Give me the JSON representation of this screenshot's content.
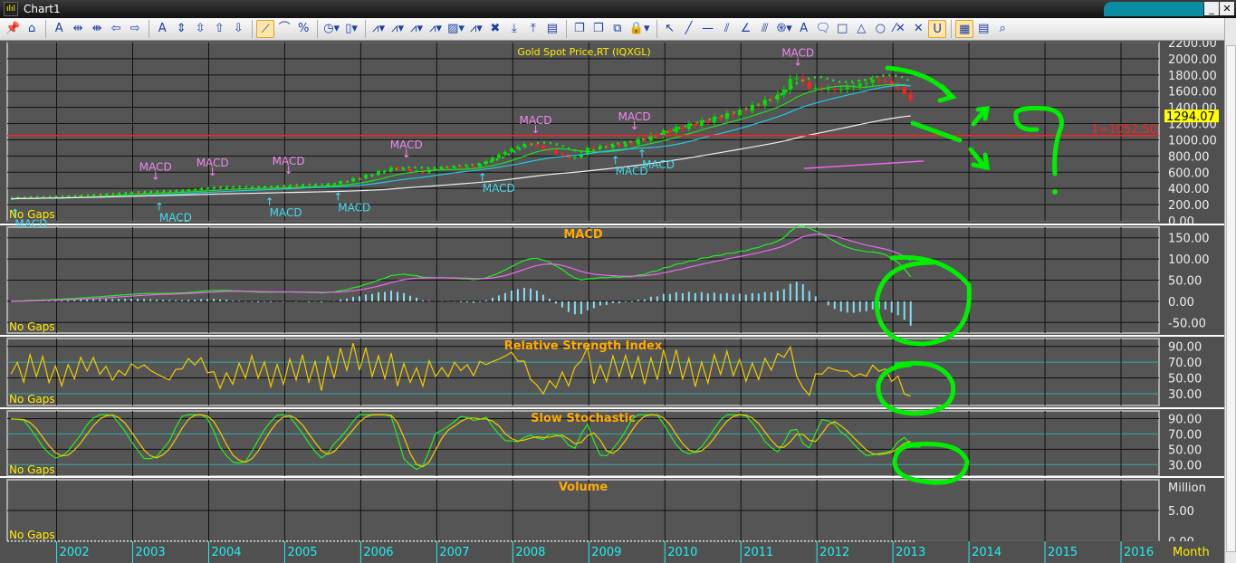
{
  "window": {
    "title": "Chart1",
    "minimize": "_",
    "maximize": "□",
    "close": "✕"
  },
  "toolbar": {
    "icons": [
      "pin-icon",
      "home-icon",
      "|",
      "font-icon",
      "zoom-in-horizontal-icon",
      "zoom-out-horizontal-icon",
      "arrow-left-icon",
      "arrow-right-icon",
      "|",
      "axis-font-icon",
      "expand-vertical-icon",
      "compress-vertical-icon",
      "arrow-up-icon",
      "arrow-down-icon",
      "|",
      "linear-scale-icon",
      "log-scale-icon",
      "percent-scale-icon",
      "|",
      "timer-icon",
      "candlestick-icon",
      "|",
      "add-indicator-icon",
      "add-study-icon",
      "indicator-overlay-icon",
      "indicator-panel-icon",
      "style-icon",
      "remove-indicator-icon",
      "delete-icon",
      "move-down-icon",
      "move-up-icon",
      "remove-panel-icon",
      "|",
      "new-chart-icon",
      "close-chart-icon",
      "copy-icon",
      "lock-icon",
      "|",
      "pointer-icon",
      "trend-line-icon",
      "horizontal-line-icon",
      "parallel-lines-icon",
      "angle-icon",
      "fan-lines-icon",
      "fibonacci-icon",
      "text-icon",
      "callout-icon",
      "rectangle-icon",
      "triangle-icon",
      "ellipse-icon",
      "delete-line-icon",
      "delete-all-icon",
      "magnet-icon",
      "|",
      "grid-icon",
      "properties-icon",
      "search-icon"
    ],
    "glyphs": {
      "pin-icon": "📌",
      "home-icon": "⌂",
      "font-icon": "A",
      "zoom-in-horizontal-icon": "⇹",
      "zoom-out-horizontal-icon": "⇼",
      "arrow-left-icon": "⇦",
      "arrow-right-icon": "⇨",
      "axis-font-icon": "A",
      "expand-vertical-icon": "⇕",
      "compress-vertical-icon": "⇳",
      "arrow-up-icon": "⇧",
      "arrow-down-icon": "⇩",
      "linear-scale-icon": "⟋",
      "log-scale-icon": "⌒",
      "percent-scale-icon": "%",
      "timer-icon": "◷▾",
      "candlestick-icon": "▯▾",
      "add-indicator-icon": "⩘▾",
      "add-study-icon": "⩘▾",
      "indicator-overlay-icon": "⩘▾",
      "indicator-panel-icon": "⩘▾",
      "style-icon": "▨▾",
      "remove-indicator-icon": "⩘▾",
      "delete-icon": "✖",
      "move-down-icon": "⤓",
      "move-up-icon": "⤒",
      "remove-panel-icon": "▤",
      "new-chart-icon": "❐",
      "close-chart-icon": "❐",
      "copy-icon": "⧉",
      "lock-icon": "🔒▾",
      "pointer-icon": "↖",
      "trend-line-icon": "╱",
      "horizontal-line-icon": "—",
      "parallel-lines-icon": "⫽",
      "angle-icon": "∠",
      "fan-lines-icon": "⫻",
      "fibonacci-icon": "֍▾",
      "text-icon": "A",
      "callout-icon": "🗨",
      "rectangle-icon": "□",
      "triangle-icon": "△",
      "ellipse-icon": "○",
      "delete-line-icon": "⁄✕",
      "delete-all-icon": "✕",
      "magnet-icon": "U",
      "grid-icon": "▦",
      "properties-icon": "▤",
      "search-icon": "⌕"
    },
    "active": [
      "linear-scale-icon",
      "magnet-icon",
      "grid-icon"
    ]
  },
  "colors": {
    "bg": "#555555",
    "up": "#00e000",
    "down": "#ff2020",
    "ma_short": "#22dd22",
    "ma_mid": "#22c8e0",
    "ma_long": "#f0f0f0",
    "macd": "#22ee22",
    "signal": "#ee66ee",
    "hist": "#88ddee",
    "rsi": "#eecc00",
    "stoch_k": "#22ee22",
    "stoch_d": "#eecc00",
    "title": "#ffee00",
    "label": "#ffaa00",
    "annot": "#00ee00",
    "hline": "#ff2020",
    "buy": "#44ddee",
    "sell": "#ee88ee"
  },
  "chart_data": {
    "type": "candlestick",
    "title": "Gold Spot Price,RT (IQXGL)",
    "x_axis": {
      "ticks": [
        "2002",
        "2003",
        "2004",
        "2005",
        "2006",
        "2007",
        "2008",
        "2009",
        "2010",
        "2011",
        "2012",
        "2013",
        "2014",
        "2015",
        "2016"
      ],
      "unit_label": "Month",
      "range": [
        2001.35,
        2016.5
      ]
    },
    "price": {
      "yticks": [
        "2200.00",
        "2000.00",
        "1800.00",
        "1600.00",
        "1400.00",
        "1200.00",
        "1000.00",
        "800.00",
        "600.00",
        "400.00",
        "200.00",
        "0.00"
      ],
      "ylim": [
        0,
        2200
      ],
      "last_value": "1294.07",
      "hline": {
        "label": "1=1052.50",
        "value": 1052.5
      },
      "anchors": [
        [
          2001.4,
          275
        ],
        [
          2002.0,
          290
        ],
        [
          2002.5,
          315
        ],
        [
          2003.0,
          345
        ],
        [
          2003.5,
          355
        ],
        [
          2004.0,
          405
        ],
        [
          2004.5,
          395
        ],
        [
          2005.0,
          425
        ],
        [
          2005.5,
          430
        ],
        [
          2006.0,
          540
        ],
        [
          2006.4,
          650
        ],
        [
          2006.8,
          600
        ],
        [
          2007.0,
          650
        ],
        [
          2007.5,
          670
        ],
        [
          2008.0,
          900
        ],
        [
          2008.2,
          960
        ],
        [
          2008.8,
          760
        ],
        [
          2009.0,
          900
        ],
        [
          2009.5,
          940
        ],
        [
          2010.0,
          1100
        ],
        [
          2010.5,
          1220
        ],
        [
          2011.0,
          1350
        ],
        [
          2011.5,
          1550
        ],
        [
          2011.7,
          1800
        ],
        [
          2011.9,
          1640
        ],
        [
          2012.3,
          1620
        ],
        [
          2012.8,
          1750
        ],
        [
          2013.0,
          1670
        ],
        [
          2013.2,
          1560
        ],
        [
          2013.3,
          1294
        ]
      ],
      "no_gaps": "No Gaps",
      "signals": [
        {
          "label": "MACD",
          "type": "buy",
          "x": 2001.45
        },
        {
          "label": "MACD",
          "type": "sell",
          "x": 2003.3
        },
        {
          "label": "MACD",
          "type": "buy",
          "x": 2003.35
        },
        {
          "label": "MACD",
          "type": "sell",
          "x": 2004.05
        },
        {
          "label": "MACD",
          "type": "buy",
          "x": 2004.8
        },
        {
          "label": "MACD",
          "type": "sell",
          "x": 2005.05
        },
        {
          "label": "MACD",
          "type": "buy",
          "x": 2005.7
        },
        {
          "label": "MACD",
          "type": "sell",
          "x": 2006.6
        },
        {
          "label": "MACD",
          "type": "buy",
          "x": 2007.6
        },
        {
          "label": "MACD",
          "type": "sell",
          "x": 2008.3
        },
        {
          "label": "MACD",
          "type": "buy",
          "x": 2009.35
        },
        {
          "label": "MACD",
          "type": "sell",
          "x": 2009.6
        },
        {
          "label": "MACD",
          "type": "buy",
          "x": 2009.7
        },
        {
          "label": "MACD",
          "type": "sell",
          "x": 2011.75
        }
      ]
    },
    "macd": {
      "title": "MACD",
      "yticks": [
        "150.00",
        "100.00",
        "50.00",
        "0.00",
        "-50.00"
      ],
      "ylim": [
        -75,
        175
      ],
      "no_gaps": "No Gaps"
    },
    "rsi": {
      "title": "Relative Strength Index",
      "yticks": [
        "90.00",
        "70.00",
        "50.00",
        "30.00"
      ],
      "ylim": [
        15,
        100
      ],
      "no_gaps": "No Gaps"
    },
    "stoch": {
      "title": "Slow Stochastic",
      "yticks": [
        "90.00",
        "70.00",
        "50.00",
        "30.00"
      ],
      "ylim": [
        15,
        100
      ],
      "no_gaps": "No Gaps"
    },
    "volume": {
      "title": "Volume",
      "yticks": [
        "5.00",
        "0.00"
      ],
      "unit": "Million",
      "ylim": [
        0,
        10
      ],
      "no_gaps": "No Gaps"
    }
  }
}
